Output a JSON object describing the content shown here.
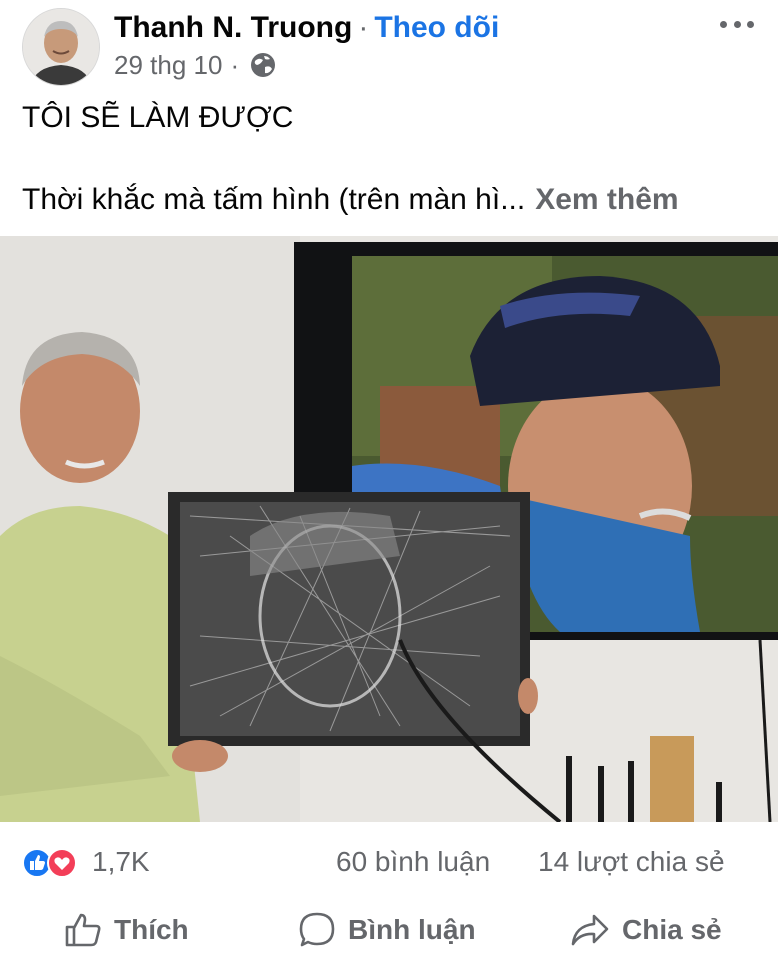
{
  "post": {
    "author": "Thanh N. Truong",
    "separator": "·",
    "follow_label": "Theo dõi",
    "date": "29 thg 10",
    "meta_sep": "·",
    "title": "TÔI SẼ LÀM ĐƯỢC",
    "body": "Thời khắc mà tấm hình (trên màn hì...",
    "see_more": "Xem thêm"
  },
  "stats": {
    "reactions": "1,7K",
    "comments": "60 bình luận",
    "shares": "14 lượt chia sẻ"
  },
  "actions": {
    "like": "Thích",
    "comment": "Bình luận",
    "share": "Chia sẻ"
  },
  "colors": {
    "accent": "#1b74e4",
    "secondary_text": "#65676b",
    "like_blue": "#1877f2",
    "love_red": "#f33e58"
  },
  "icons": [
    "globe-icon",
    "more-options-icon",
    "like-reaction-icon",
    "love-reaction-icon",
    "thumbs-up-icon",
    "comment-bubble-icon",
    "share-arrow-icon"
  ]
}
